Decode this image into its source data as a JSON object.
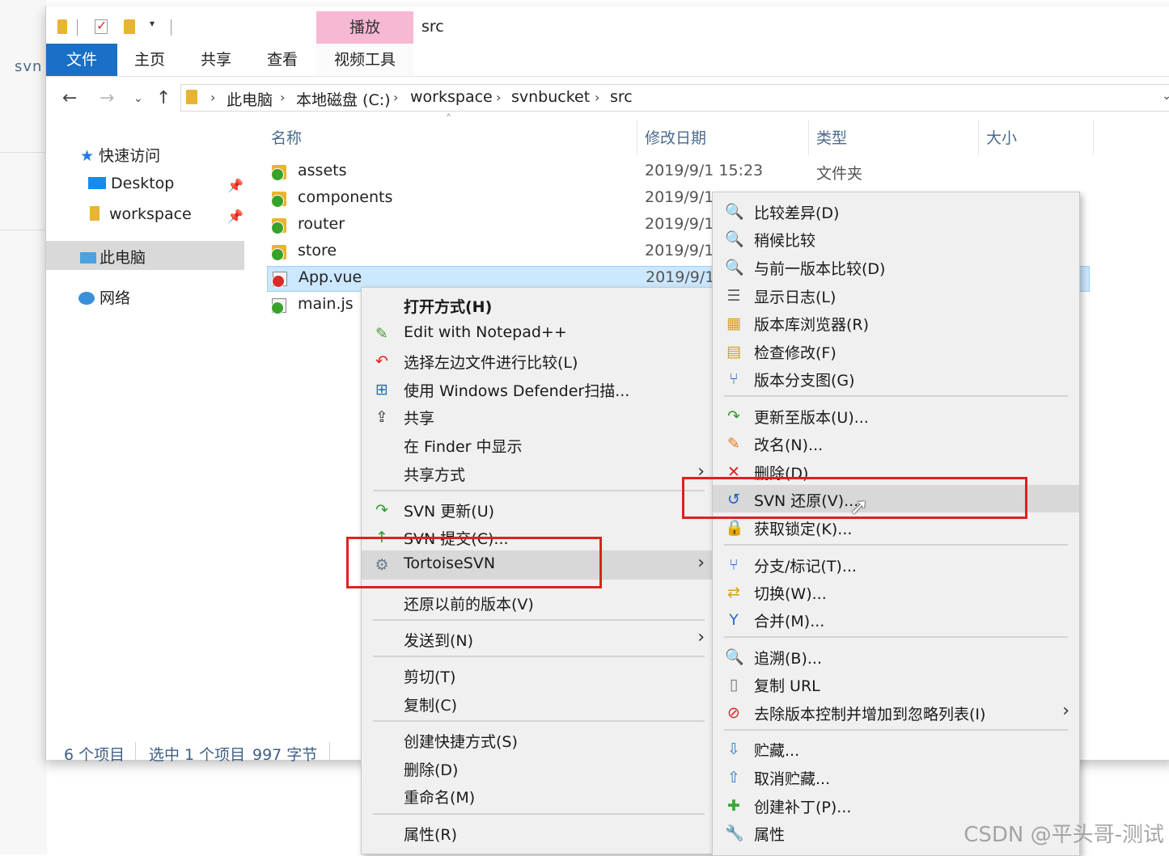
{
  "background": {
    "side_text": "svn"
  },
  "window": {
    "title": "src",
    "contextual_tab_header": "播放",
    "ribbon_tabs": [
      "文件",
      "主页",
      "共享",
      "查看",
      "视频工具"
    ],
    "active_tab_color": "#1a6fc6",
    "contextual_tab_color": "#f7b8d4"
  },
  "address_bar": {
    "crumbs": [
      "此电脑",
      "本地磁盘 (C:)",
      "workspace",
      "svnbucket",
      "src"
    ]
  },
  "nav_pane": {
    "quick_access": "快速访问",
    "pinned": [
      "Desktop",
      "workspace"
    ],
    "this_pc": "此电脑",
    "network": "网络"
  },
  "columns": [
    "名称",
    "修改日期",
    "类型",
    "大小"
  ],
  "files": [
    {
      "name": "assets",
      "date": "2019/9/1 15:23",
      "type": "文件夹"
    },
    {
      "name": "components",
      "date": "2019/9/1"
    },
    {
      "name": "router",
      "date": "2019/9/1"
    },
    {
      "name": "store",
      "date": "2019/9/1"
    },
    {
      "name": "App.vue",
      "date": "2019/9/1"
    },
    {
      "name": "main.js"
    }
  ],
  "status_bar": {
    "item_count": "6 个项目",
    "selection": "选中 1 个项目",
    "size": "997 字节"
  },
  "context_menu": {
    "items": [
      {
        "label": "打开方式(H)",
        "icon": "open-with"
      },
      {
        "label": "Edit with Notepad++",
        "icon": "notepad-plus-icon"
      },
      {
        "label": "选择左边文件进行比较(L)",
        "icon": "compare-left-icon"
      },
      {
        "label": "使用 Windows Defender扫描...",
        "icon": "defender-icon"
      },
      {
        "label": "共享",
        "icon": "share-icon"
      },
      {
        "label": "在 Finder 中显示"
      },
      {
        "label": "共享方式"
      },
      {
        "label": "SVN 更新(U)",
        "icon": "svn-update-icon"
      },
      {
        "label": "SVN 提交(C)...",
        "icon": "svn-commit-icon"
      },
      {
        "label": "TortoiseSVN",
        "icon": "tortoise-svn-icon"
      },
      {
        "label": "还原以前的版本(V)"
      },
      {
        "label": "发送到(N)"
      },
      {
        "label": "剪切(T)"
      },
      {
        "label": "复制(C)"
      },
      {
        "label": "创建快捷方式(S)"
      },
      {
        "label": "删除(D)"
      },
      {
        "label": "重命名(M)"
      },
      {
        "label": "属性(R)"
      }
    ]
  },
  "submenu": {
    "items": [
      {
        "label": "比较差异(D)",
        "icon": "diff-icon"
      },
      {
        "label": "稍候比较",
        "icon": "diff-later-icon"
      },
      {
        "label": "与前一版本比较(D)",
        "icon": "diff-previous-icon"
      },
      {
        "label": "显示日志(L)",
        "icon": "log-icon"
      },
      {
        "label": "版本库浏览器(R)",
        "icon": "repo-browser-icon"
      },
      {
        "label": "检查修改(F)",
        "icon": "check-modifications-icon"
      },
      {
        "label": "版本分支图(G)",
        "icon": "revision-graph-icon"
      },
      {
        "label": "更新至版本(U)...",
        "icon": "update-to-revision-icon"
      },
      {
        "label": "改名(N)...",
        "icon": "rename-icon"
      },
      {
        "label": "删除(D)",
        "icon": "delete-icon"
      },
      {
        "label": "SVN 还原(V)...",
        "icon": "svn-revert-icon"
      },
      {
        "label": "获取锁定(K)...",
        "icon": "lock-icon"
      },
      {
        "label": "分支/标记(T)...",
        "icon": "branch-icon"
      },
      {
        "label": "切换(W)...",
        "icon": "switch-icon"
      },
      {
        "label": "合并(M)...",
        "icon": "merge-icon"
      },
      {
        "label": "追溯(B)...",
        "icon": "blame-icon"
      },
      {
        "label": "复制 URL",
        "icon": "copy-url-icon"
      },
      {
        "label": "去除版本控制并增加到忽略列表(I)",
        "icon": "ignore-icon"
      },
      {
        "label": "贮藏...",
        "icon": "shelve-icon"
      },
      {
        "label": "取消贮藏...",
        "icon": "unshelve-icon"
      },
      {
        "label": "创建补丁(P)...",
        "icon": "patch-icon"
      },
      {
        "label": "属性",
        "icon": "properties-icon"
      }
    ]
  },
  "highlight_color": "#e02020",
  "watermark": "CSDN @平头哥-测试"
}
